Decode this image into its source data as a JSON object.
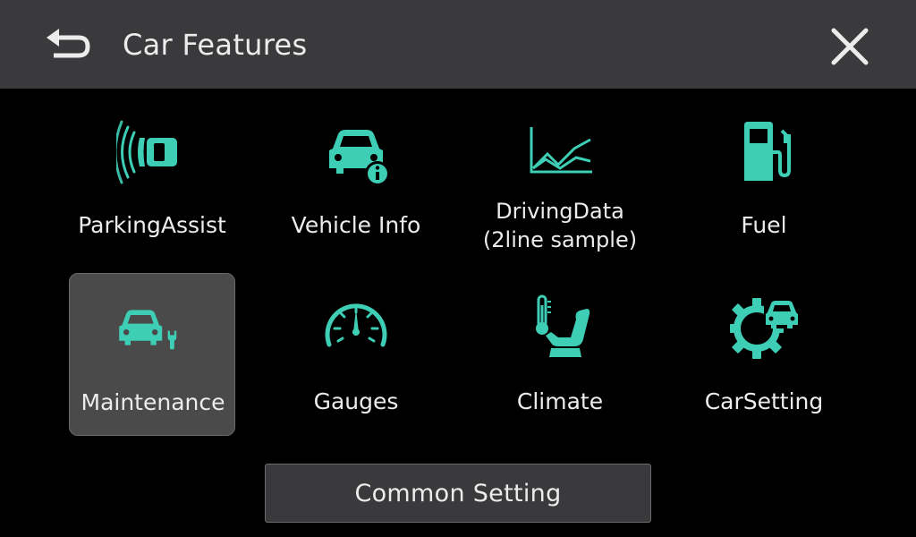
{
  "header": {
    "title": "Car Features",
    "back_icon": "back-arrow-icon",
    "close_icon": "close-icon"
  },
  "colors": {
    "accent": "#3ecdb5",
    "header_bg": "#3a3a3c",
    "selected_tile_bg": "#4a4a4a"
  },
  "tiles": [
    {
      "label": "ParkingAssist",
      "icon": "parking-assist-icon"
    },
    {
      "label": "Vehicle Info",
      "icon": "vehicle-info-icon"
    },
    {
      "label_line1": "DrivingData",
      "label_line2": "(2line sample)",
      "icon": "driving-data-icon"
    },
    {
      "label": "Fuel",
      "icon": "fuel-pump-icon"
    },
    {
      "label": "Maintenance",
      "icon": "maintenance-icon",
      "selected": true
    },
    {
      "label": "Gauges",
      "icon": "gauge-icon"
    },
    {
      "label": "Climate",
      "icon": "climate-icon"
    },
    {
      "label": "CarSetting",
      "icon": "car-setting-icon"
    }
  ],
  "footer": {
    "common_setting_label": "Common Setting"
  }
}
